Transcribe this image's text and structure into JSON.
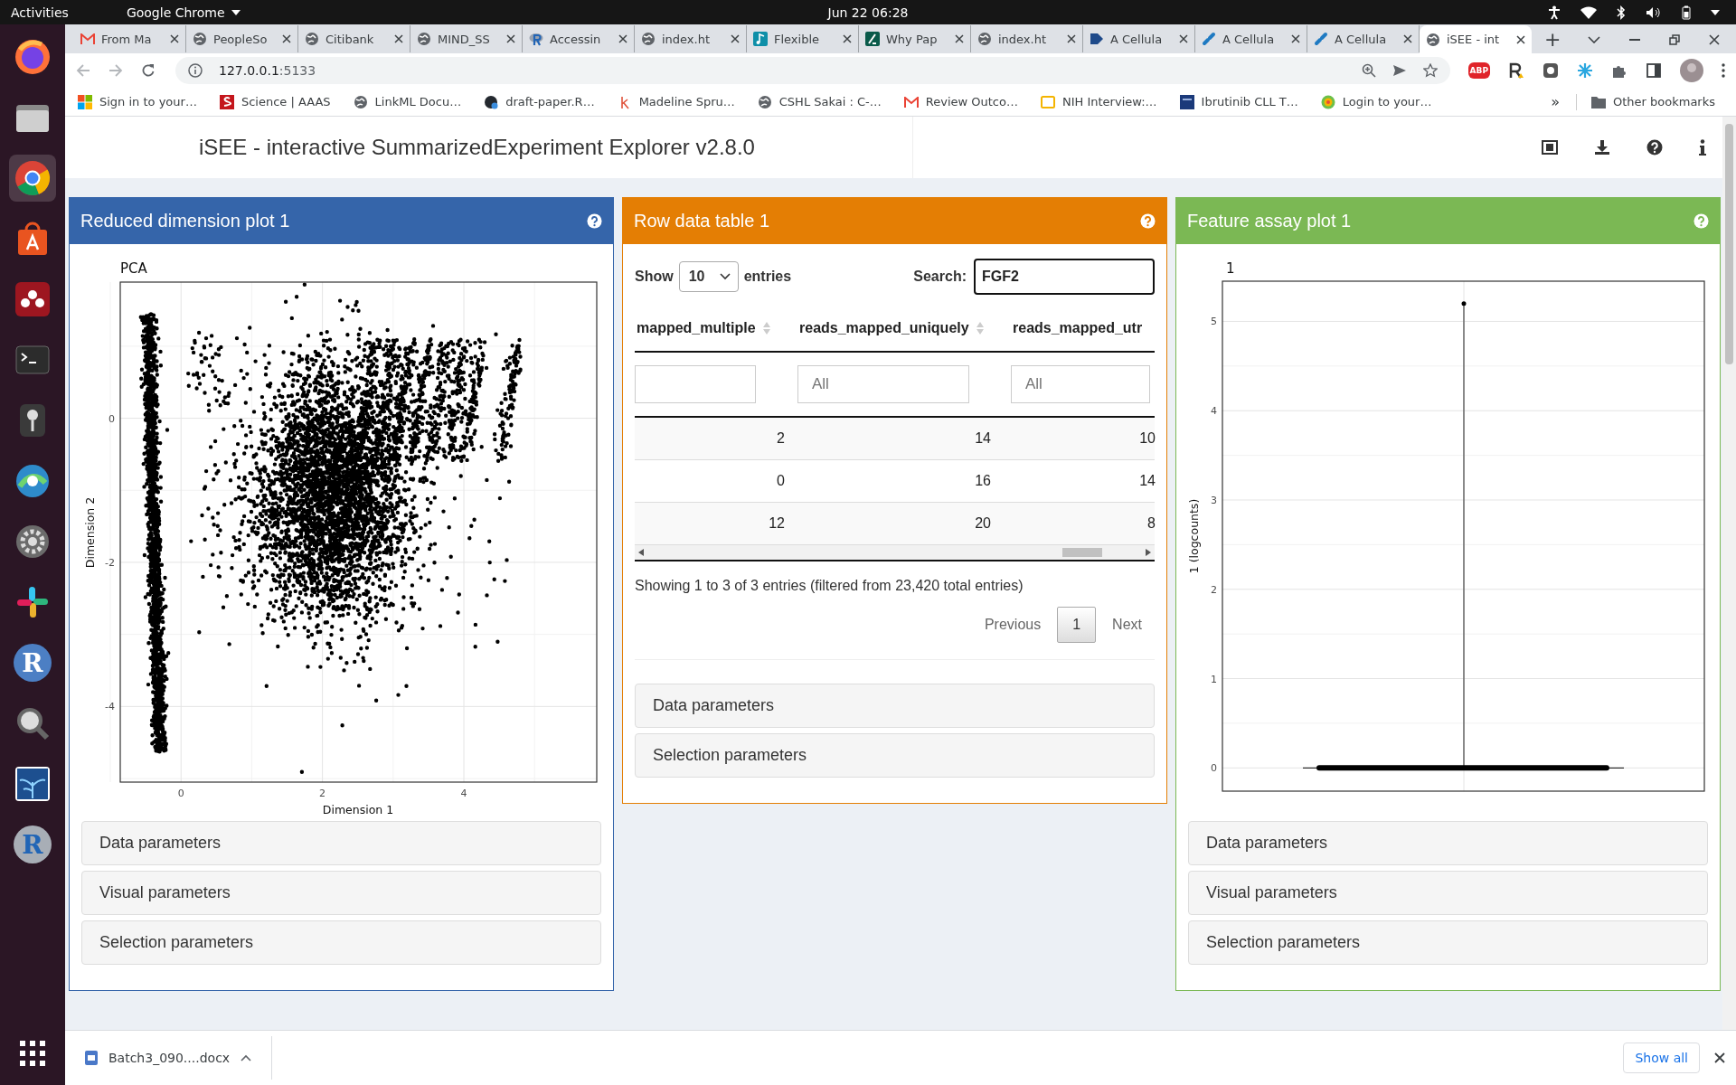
{
  "top_bar": {
    "activities": "Activities",
    "app_menu": "Google Chrome",
    "clock": "Jun 22  06:28"
  },
  "dock": [
    {
      "kind": "firefox",
      "selected": false
    },
    {
      "kind": "files",
      "selected": false
    },
    {
      "kind": "chrome",
      "selected": true
    },
    {
      "kind": "software",
      "selected": false
    },
    {
      "kind": "mendeley",
      "selected": false
    },
    {
      "kind": "terminal",
      "selected": false
    },
    {
      "kind": "pin",
      "selected": false
    },
    {
      "kind": "swirl",
      "selected": false
    },
    {
      "kind": "settings",
      "selected": false
    },
    {
      "kind": "slack",
      "selected": false
    },
    {
      "kind": "r",
      "selected": false,
      "glyph": "R"
    },
    {
      "kind": "magnifier",
      "selected": false
    },
    {
      "kind": "plant",
      "selected": false
    },
    {
      "kind": "rstudio",
      "selected": false,
      "glyph": "R"
    }
  ],
  "tabs": [
    {
      "title": "From Ma",
      "kind": "mail",
      "selected": false
    },
    {
      "title": "PeopleSo",
      "kind": "globe",
      "selected": false
    },
    {
      "title": "Citibank",
      "kind": "globe",
      "selected": false
    },
    {
      "title": "MIND_SS",
      "kind": "globe",
      "selected": false
    },
    {
      "title": "Accessin",
      "kind": "rlogo",
      "selected": false
    },
    {
      "title": "index.ht",
      "kind": "globe",
      "selected": false
    },
    {
      "title": "Flexible",
      "kind": "note",
      "selected": false
    },
    {
      "title": "Why Pap",
      "kind": "slash",
      "selected": false
    },
    {
      "title": "index.ht",
      "kind": "globe",
      "selected": false
    },
    {
      "title": "A Cellula",
      "kind": "chevron",
      "selected": false
    },
    {
      "title": "A Cellula",
      "kind": "link",
      "selected": false
    },
    {
      "title": "A Cellula",
      "kind": "link",
      "selected": false
    },
    {
      "title": "iSEE - int",
      "kind": "globe",
      "selected": true
    }
  ],
  "new_tab": "+",
  "address": {
    "host": "127.0.0.1",
    "port": ":5133"
  },
  "adblock_label": "ABP",
  "bookmarks": [
    {
      "title": "Sign in to your…",
      "kind": "windows"
    },
    {
      "title": "Science | AAAS",
      "kind": "science"
    },
    {
      "title": "LinkML Docu…",
      "kind": "globe"
    },
    {
      "title": "draft-paper.R…",
      "kind": "cat"
    },
    {
      "title": "Madeline Spru…",
      "kind": "k"
    },
    {
      "title": "CSHL Sakai : C-…",
      "kind": "globe"
    },
    {
      "title": "Review Outco…",
      "kind": "mail"
    },
    {
      "title": "NIH Interview:…",
      "kind": "slides"
    },
    {
      "title": "Ibrutinib CLL T…",
      "kind": "square"
    },
    {
      "title": "Login to your…",
      "kind": "dots"
    }
  ],
  "bookmarks_more": "»",
  "other_bookmarks": "Other bookmarks",
  "app": {
    "title": "iSEE - interactive SummarizedExperiment Explorer v2.8.0",
    "panels": [
      {
        "kind": "reduced_dim",
        "title": "Reduced dimension plot 1",
        "color": "#3565aa",
        "plot": {
          "title": "PCA",
          "xlabel": "Dimension 1",
          "ylabel": "Dimension 2",
          "xticks": [
            "0",
            "2",
            "4"
          ],
          "yticks": [
            "0",
            "-2",
            "-4"
          ]
        },
        "sections": [
          "Data parameters",
          "Visual parameters",
          "Selection parameters"
        ]
      },
      {
        "kind": "table",
        "title": "Row data table 1",
        "color": "#e47e04",
        "show_label": "Show",
        "length": "10",
        "entries_label": "entries",
        "search_label": "Search:",
        "search_value": "FGF2",
        "columns": [
          {
            "name": "mapped_multiple",
            "sortable": true
          },
          {
            "name": "reads_mapped_uniquely",
            "sortable": true,
            "placeholder": "All"
          },
          {
            "name": "reads_mapped_utr",
            "sortable": false,
            "placeholder": "All"
          }
        ],
        "rows": [
          [
            "2",
            "14",
            "10"
          ],
          [
            "0",
            "16",
            "14"
          ],
          [
            "12",
            "20",
            "8"
          ]
        ],
        "info": "Showing 1 to 3 of 3 entries (filtered from 23,420 total entries)",
        "previous": "Previous",
        "pages": [
          {
            "label": "1",
            "selected": true
          }
        ],
        "next": "Next",
        "sections": [
          "Data parameters",
          "Selection parameters"
        ]
      },
      {
        "kind": "feature_assay",
        "title": "Feature assay plot 1",
        "color": "#7bb854",
        "plot": {
          "title": "1",
          "ylabel": "1 (logcounts)",
          "yticks": [
            "5",
            "4",
            "3",
            "2",
            "1",
            "0"
          ]
        },
        "sections": [
          "Data parameters",
          "Visual parameters",
          "Selection parameters"
        ]
      }
    ]
  },
  "downloads": {
    "file": "Batch3_090....docx",
    "show_all": "Show all"
  }
}
